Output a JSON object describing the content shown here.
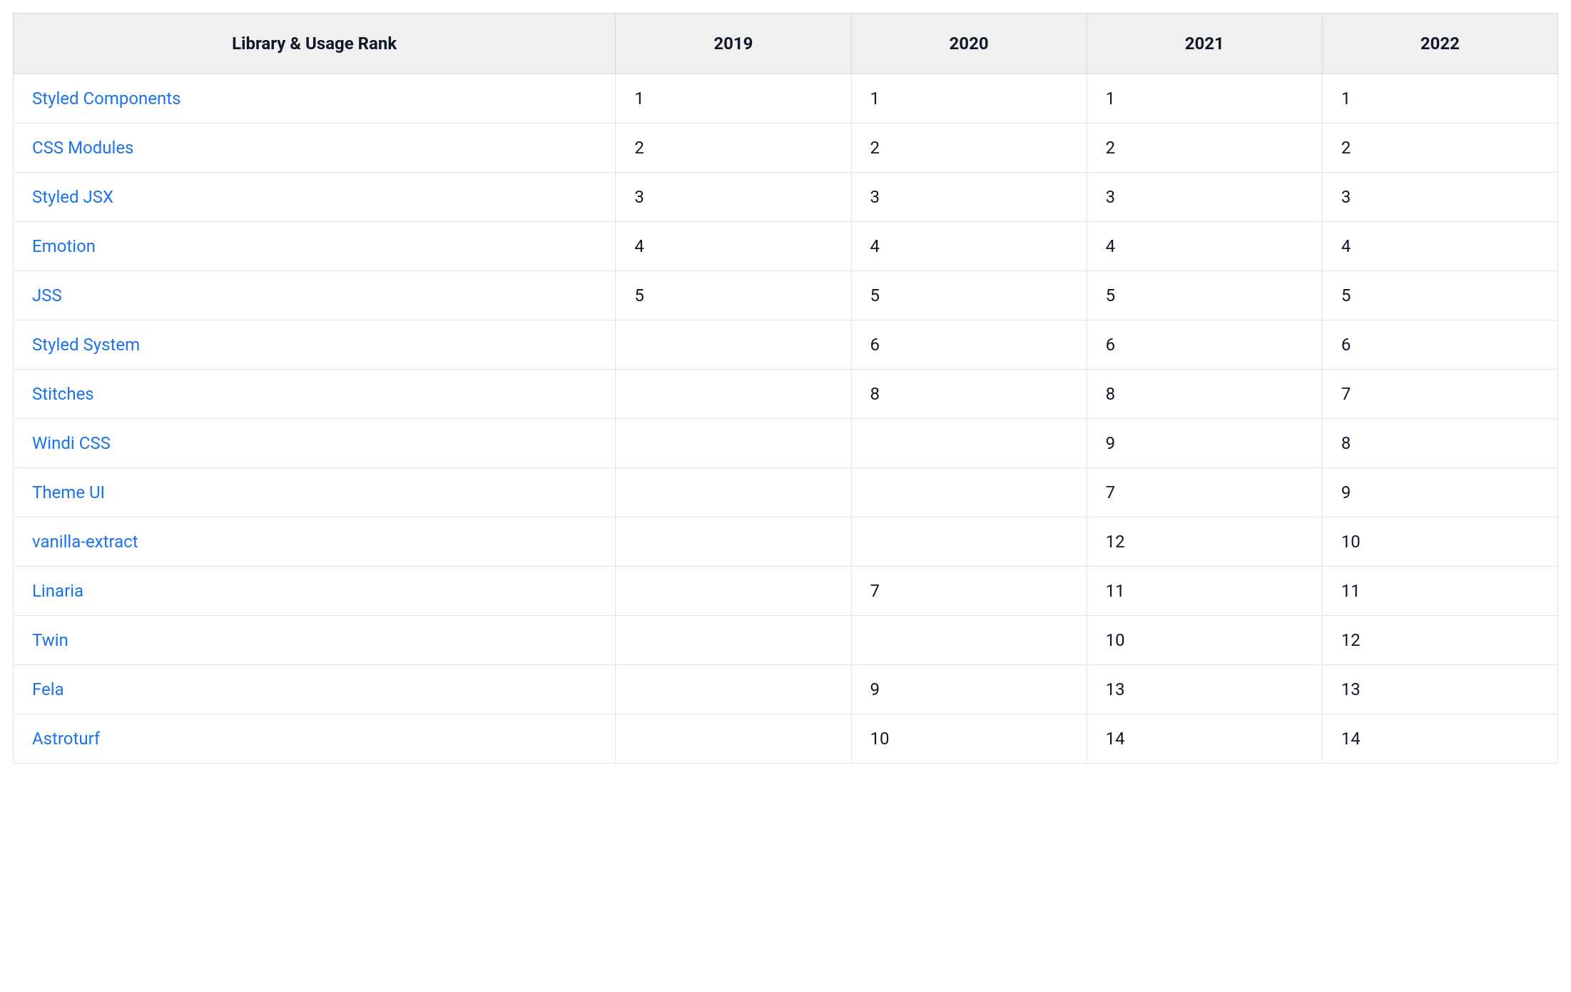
{
  "chart_data": {
    "type": "table",
    "title": "",
    "columns": [
      "Library & Usage Rank",
      "2019",
      "2020",
      "2021",
      "2022"
    ],
    "rows": [
      {
        "library": "Styled Components",
        "2019": "1",
        "2020": "1",
        "2021": "1",
        "2022": "1"
      },
      {
        "library": "CSS Modules",
        "2019": "2",
        "2020": "2",
        "2021": "2",
        "2022": "2"
      },
      {
        "library": "Styled JSX",
        "2019": "3",
        "2020": "3",
        "2021": "3",
        "2022": "3"
      },
      {
        "library": "Emotion",
        "2019": "4",
        "2020": "4",
        "2021": "4",
        "2022": "4"
      },
      {
        "library": "JSS",
        "2019": "5",
        "2020": "5",
        "2021": "5",
        "2022": "5"
      },
      {
        "library": "Styled System",
        "2019": "",
        "2020": "6",
        "2021": "6",
        "2022": "6"
      },
      {
        "library": "Stitches",
        "2019": "",
        "2020": "8",
        "2021": "8",
        "2022": "7"
      },
      {
        "library": "Windi CSS",
        "2019": "",
        "2020": "",
        "2021": "9",
        "2022": "8"
      },
      {
        "library": "Theme UI",
        "2019": "",
        "2020": "",
        "2021": "7",
        "2022": "9"
      },
      {
        "library": "vanilla-extract",
        "2019": "",
        "2020": "",
        "2021": "12",
        "2022": "10"
      },
      {
        "library": "Linaria",
        "2019": "",
        "2020": "7",
        "2021": "11",
        "2022": "11"
      },
      {
        "library": "Twin",
        "2019": "",
        "2020": "",
        "2021": "10",
        "2022": "12"
      },
      {
        "library": "Fela",
        "2019": "",
        "2020": "9",
        "2021": "13",
        "2022": "13"
      },
      {
        "library": "Astroturf",
        "2019": "",
        "2020": "10",
        "2021": "14",
        "2022": "14"
      }
    ]
  }
}
